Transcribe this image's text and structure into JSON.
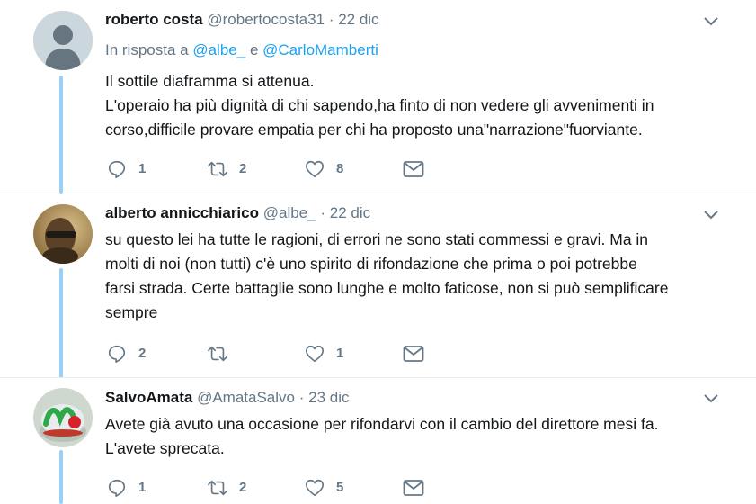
{
  "tweets": [
    {
      "name": "roberto costa",
      "handle": "@robertocosta31",
      "dot": "·",
      "date": "22 dic",
      "reply_prefix": "In risposta a",
      "reply_user1": "@albe_",
      "reply_and": "e",
      "reply_user2": "@CarloMamberti",
      "lines": [
        "Il sottile diaframma si attenua.",
        "L'operaio ha più dignità di chi sapendo,ha finto di non vedere gli avvenimenti in",
        "corso,difficile provare empatia per chi ha proposto una\"narrazione\"fuorviante."
      ],
      "replies": "1",
      "retweets": "2",
      "likes": "8"
    },
    {
      "name": "alberto annicchiarico",
      "handle": "@albe_",
      "dot": "·",
      "date": "22 dic",
      "lines": [
        "su questo lei ha tutte le ragioni, di errori ne sono stati commessi e gravi. Ma in",
        "molti di noi (non tutti) c'è uno spirito di rifondazione che prima o poi potrebbe",
        "farsi strada. Certe battaglie sono lunghe e molto faticose, non si può semplificare",
        "sempre"
      ],
      "replies": "2",
      "retweets": "",
      "likes": "1"
    },
    {
      "name": "SalvoAmata",
      "handle": "@AmataSalvo",
      "dot": "·",
      "date": "23 dic",
      "lines": [
        "Avete già avuto una occasione per rifondarvi con il cambio del direttore mesi fa.",
        "L'avete sprecata."
      ],
      "replies": "1",
      "retweets": "2",
      "likes": "5"
    }
  ],
  "icons": {
    "reply": "reply-icon",
    "retweet": "retweet-icon",
    "like": "heart-icon",
    "dm": "envelope-icon",
    "caret": "chevron-down-icon"
  },
  "colors": {
    "thread_line": "#9ad0f5",
    "link": "#1da1f2",
    "muted": "#657786",
    "text": "#14171a"
  }
}
